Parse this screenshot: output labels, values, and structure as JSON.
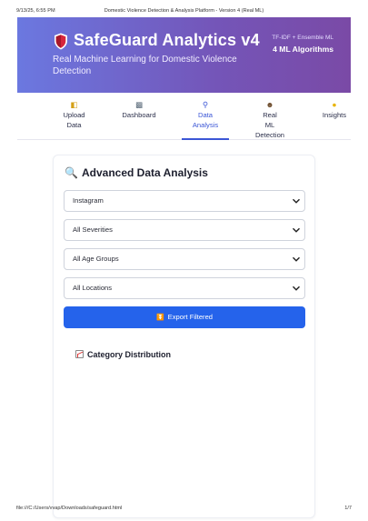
{
  "print": {
    "datetime": "9/13/25, 6:55 PM",
    "doc_title": "Domestic Violence Detection & Analysis Platform - Version 4 (Real ML)",
    "file_path": "file:///C:/Users/vvap/Downloads/safeguard.html",
    "page_counter": "1/7"
  },
  "hero": {
    "icon": "shield-icon",
    "title": "SafeGuard Analytics v4",
    "subtitle": "Real Machine Learning for Domestic Violence Detection",
    "tech": "TF-IDF + Ensemble ML",
    "models": "4 ML Algorithms"
  },
  "nav": {
    "tabs": [
      {
        "icon": "folder-icon",
        "line1": "Upload",
        "line2": "Data",
        "line3": "",
        "active": false
      },
      {
        "icon": "bar-chart-icon",
        "line1": "Dashboard",
        "line2": "",
        "line3": "",
        "active": false
      },
      {
        "icon": "magnifier-icon",
        "line1": "Data",
        "line2": "Analysis",
        "line3": "",
        "active": true
      },
      {
        "icon": "robot-icon",
        "line1": "Real",
        "line2": "ML",
        "line3": "Detection",
        "active": false
      },
      {
        "icon": "lightbulb-icon",
        "line1": "Insights",
        "line2": "",
        "line3": "",
        "active": false
      }
    ]
  },
  "analysis": {
    "title": "Advanced Data Analysis",
    "filters": {
      "platform": "Instagram",
      "severity": "All Severities",
      "age_group": "All Age Groups",
      "location": "All Locations"
    },
    "export_label": "Export Filtered",
    "category_title": "Category Distribution"
  },
  "colors": {
    "hero_gradient_start": "#6b78e0",
    "hero_gradient_end": "#7a4aa6",
    "accent": "#3b56d6",
    "export_button": "#2563eb"
  }
}
